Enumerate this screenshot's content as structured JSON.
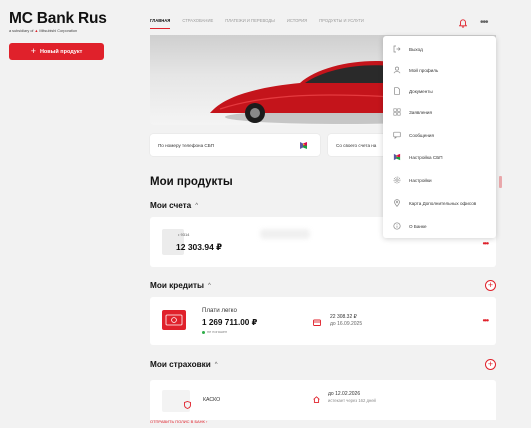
{
  "sidebar": {
    "logo_title": "MC Bank Rus",
    "logo_sub_prefix": "a subsidiary of",
    "logo_sub_brand": "Mitsubishi Corporation",
    "new_product_label": "Новый продукт"
  },
  "nav": {
    "tabs": [
      "Главная",
      "Страхование",
      "Платежи и переводы",
      "История",
      "Продукты и услуги"
    ],
    "active_tab": "Главная"
  },
  "sbp": {
    "by_phone": "По номеру телефона СБП",
    "own_account": "Со своего счета на"
  },
  "products": {
    "title": "Мои продукты",
    "accounts": {
      "title": "Мои счета",
      "items": [
        {
          "mask": "• 9314",
          "amount": "12 303.94 ₽"
        }
      ]
    },
    "credits": {
      "title": "Мои кредиты",
      "items": [
        {
          "name": "Плати легко",
          "amount": "1 269 711.00 ₽",
          "status": "не погашен",
          "payment_amount": "22 308.32 ₽",
          "payment_date": "до 16.09.2025"
        }
      ]
    },
    "insurance": {
      "title": "Мои страховки",
      "items": [
        {
          "name": "КАСКО",
          "date": "до 12.02.2026",
          "expires": "истекает через 162 дней"
        }
      ],
      "send_link": "Отправить полис в банк"
    }
  },
  "menu": {
    "items": [
      {
        "label": "Выход",
        "icon": "logout-icon"
      },
      {
        "label": "Мой профиль",
        "icon": "user-icon"
      },
      {
        "label": "Документы",
        "icon": "document-icon"
      },
      {
        "label": "Заявления",
        "icon": "grid-icon"
      },
      {
        "label": "Сообщения",
        "icon": "message-icon"
      },
      {
        "label": "Настройка СБП",
        "icon": "sbp-icon"
      },
      {
        "label": "Настройки",
        "icon": "gear-icon"
      },
      {
        "label": "Карта Дополнительных офисов",
        "icon": "location-icon"
      },
      {
        "label": "О Банке",
        "icon": "info-icon"
      }
    ]
  },
  "colors": {
    "accent": "#e0212b",
    "background": "#f2f2f2",
    "card": "#ffffff"
  }
}
